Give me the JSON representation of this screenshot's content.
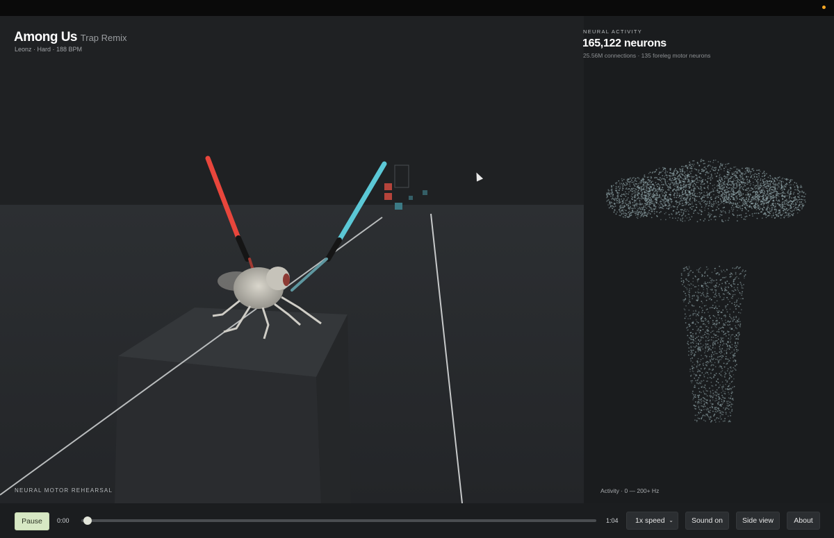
{
  "song": {
    "title": "Among Us",
    "subtitle": "Trap Remix",
    "meta": "Leonz · Hard · 188 BPM"
  },
  "scene": {
    "label": "NEURAL MOTOR REHEARSAL",
    "saber_left_color": "#e8463c",
    "saber_right_color": "#5bc8d6"
  },
  "neural": {
    "label": "NEURAL ACTIVITY",
    "count": "165,122 neurons",
    "detail": "25.56M connections · 135 foreleg motor neurons",
    "legend": "Activity · 0 — 200+ Hz"
  },
  "controls": {
    "pause_label": "Pause",
    "time_current": "0:00",
    "time_total": "1:04",
    "progress": 0.01,
    "speed_label": "1x speed",
    "sound_label": "Sound on",
    "side_view_label": "Side view",
    "about_label": "About"
  },
  "colors": {
    "accent": "#d7e8c4",
    "indicator": "#f5a623"
  }
}
